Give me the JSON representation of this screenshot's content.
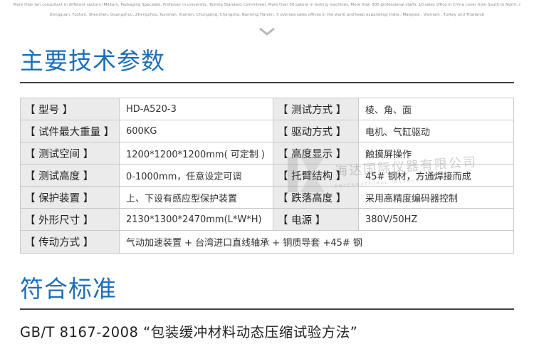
{
  "intro": {
    "line1": "More than ten consultant in different sectors (Military, Packaging Specialist, Professor in university, Testing Standard committee). More than 50 patent in testing machines. More than 300 professional staffs. 10 sales office in China cover from South to North. (",
    "line2": "Dongguan, Foshan, Shenzhen, Guangzhou, Zhengzhou, Kunshan, Xiamen, Chongqing, Changsha, Nanning,Tianjin). 5 oversea sales offices in the world and keep expanding( India , Malaysia , Vietnam , Turkey and Thailand)"
  },
  "section1": {
    "title": "主要技术参数"
  },
  "params": {
    "rows": [
      {
        "label1": "【 型号 】",
        "value1": "HD-A520-3",
        "label2": "【 测试方式 】",
        "value2": "棱、角、面"
      },
      {
        "label1": "【 试件最大重量 】",
        "value1": "600KG",
        "label2": "【 驱动方式 】",
        "value2": "电机、气缸驱动"
      },
      {
        "label1": "【 测试空间 】",
        "value1": "1200*1200*1200mm( 可定制 )",
        "label2": "【 高度显示 】",
        "value2": "触摸屏操作"
      },
      {
        "label1": "【 测试高度 】",
        "value1": "0-1000mm，任意设定可调",
        "label2": "【 托臂结构 】",
        "value2": "45# 钢材，方通焊接而成"
      },
      {
        "label1": "【 保护装置 】",
        "value1": "上、下设有感应型保护装置",
        "label2": "【 跌落高度 】",
        "value2": "采用高精度编码器控制"
      },
      {
        "label1": "【 外形尺寸 】",
        "value1": "2130*1300*2470mm(L*W*H)",
        "label2": "【 电源 】",
        "value2": "380V/50HZ"
      }
    ],
    "last_row": {
      "label": "【 传动方式 】",
      "value": "气动加速装置 + 台湾进口直线轴承 + 铜质导套 +45# 钢"
    }
  },
  "watermark": {
    "cn": "海达国际仪器有限公司",
    "en": "ENTERNATIONAL INSTRUMENT CO.,LTD"
  },
  "section2": {
    "title": "符合标准"
  },
  "standard": {
    "text": "GB/T 8167-2008 “包装缓冲材料动态压缩试验方法”"
  },
  "colors": {
    "title_blue": "#1e6fb8",
    "label_bg": "#ebebeb",
    "border": "#c9c9c9"
  },
  "icons": {
    "divider": "chevron-down-icon",
    "watermark": "company-logo-watermark"
  }
}
